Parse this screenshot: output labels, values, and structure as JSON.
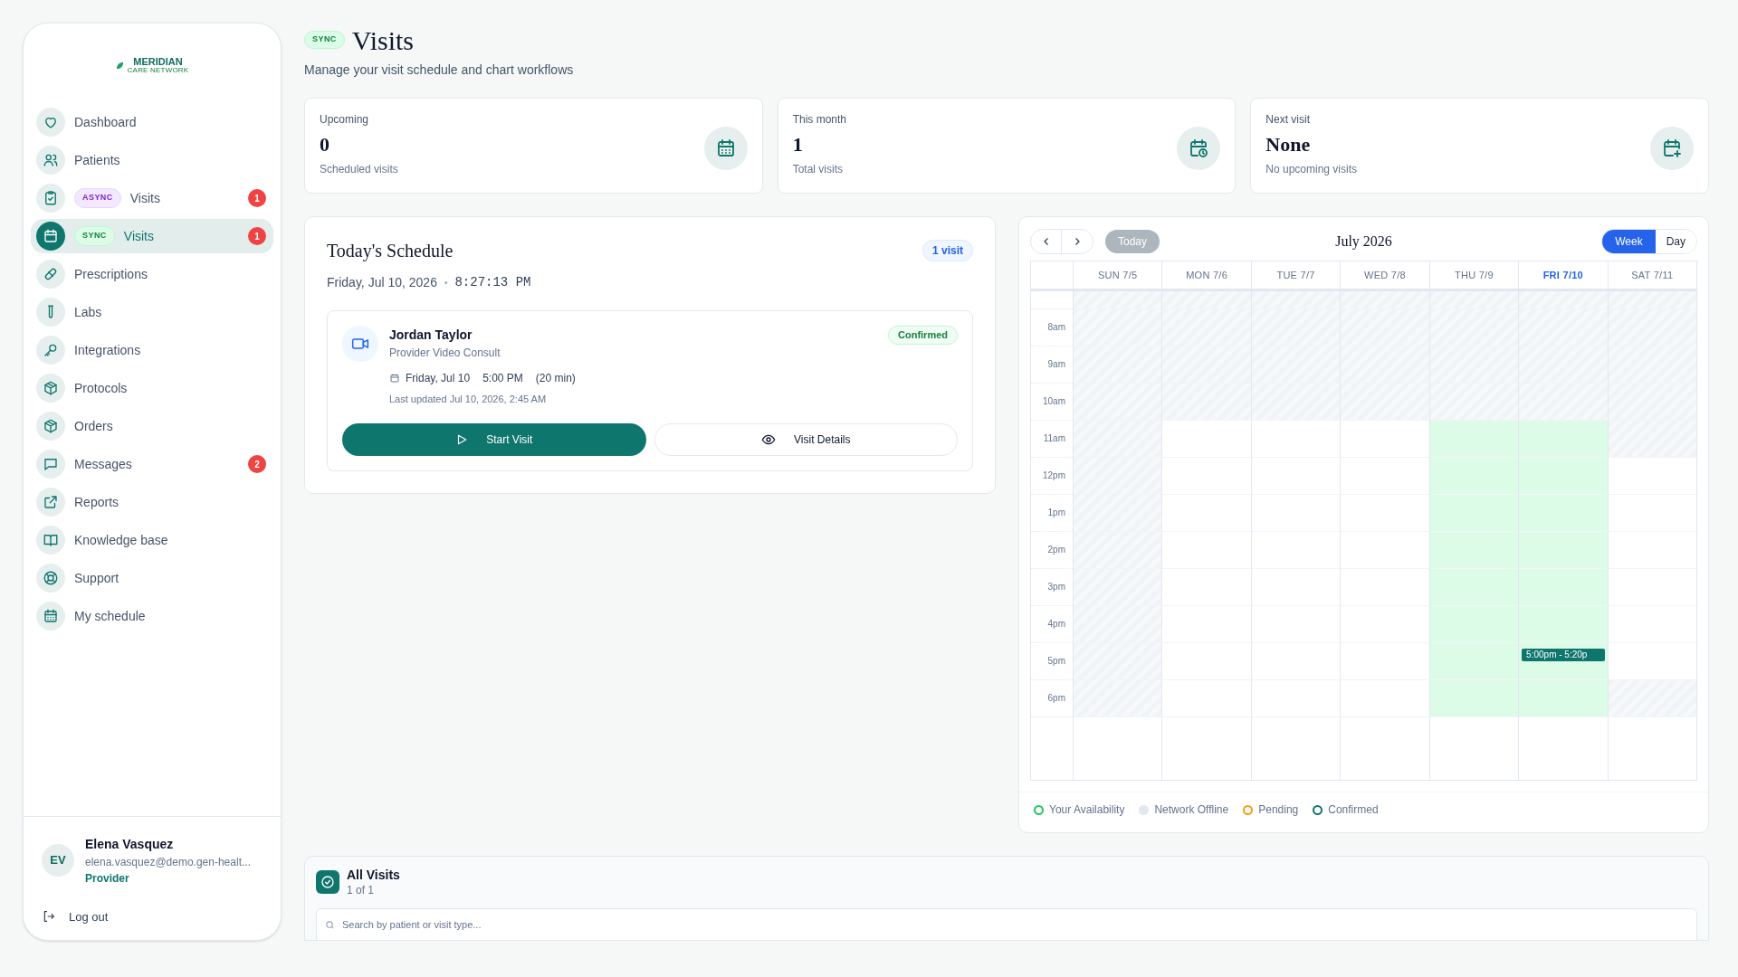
{
  "logo": {
    "name": "MERIDIAN",
    "tagline": "CARE NETWORK"
  },
  "sidebar": {
    "items": [
      {
        "kind": "heart",
        "label": "Dashboard",
        "selected": false
      },
      {
        "kind": "users",
        "label": "Patients",
        "selected": false
      },
      {
        "kind": "clipboard",
        "label": "Visits",
        "tag": {
          "label": "ASYNC",
          "kind": "async"
        },
        "badge": "1",
        "selected": false
      },
      {
        "kind": "calendar",
        "label": "Visits",
        "tag": {
          "label": "SYNC",
          "kind": "sync"
        },
        "badge": "1",
        "selected": true
      },
      {
        "kind": "pill",
        "label": "Prescriptions",
        "selected": false
      },
      {
        "kind": "tube",
        "label": "Labs",
        "selected": false
      },
      {
        "kind": "key",
        "label": "Integrations",
        "selected": false
      },
      {
        "kind": "box",
        "label": "Protocols",
        "selected": false
      },
      {
        "kind": "box",
        "label": "Orders",
        "selected": false
      },
      {
        "kind": "message",
        "label": "Messages",
        "badge": "2",
        "selected": false
      },
      {
        "kind": "external",
        "label": "Reports",
        "selected": false
      },
      {
        "kind": "book",
        "label": "Knowledge base",
        "selected": false
      },
      {
        "kind": "lifebuoy",
        "label": "Support",
        "selected": false
      },
      {
        "kind": "grid",
        "label": "My schedule",
        "selected": false
      }
    ],
    "user": {
      "initials": "EV",
      "name": "Elena Vasquez",
      "email": "elena.vasquez@demo.gen-healt...",
      "role": "Provider"
    },
    "logout": "Log out"
  },
  "header": {
    "tag": "SYNC",
    "title": "Visits",
    "subtitle": "Manage your visit schedule and chart workflows"
  },
  "stats": [
    {
      "label": "Upcoming",
      "value": "0",
      "caption": "Scheduled visits",
      "kind": "grid"
    },
    {
      "label": "This month",
      "value": "1",
      "caption": "Total visits",
      "kind": "clock"
    },
    {
      "label": "Next visit",
      "value": "None",
      "caption": "No upcoming visits",
      "kind": "plus"
    }
  ],
  "schedule": {
    "title": "Today's Schedule",
    "count": "1 visit",
    "date": "Friday, Jul 10, 2026",
    "separator": "•",
    "time": "8:27:13 PM",
    "visits": [
      {
        "patient": "Jordan Taylor",
        "type": "Provider Video Consult",
        "status": "Confirmed",
        "date": "Friday, Jul 10",
        "time": "5:00 PM",
        "duration": "(20 min)",
        "updated": "Last updated Jul 10, 2026, 2:45 AM",
        "primary_action": "Start Visit",
        "secondary_action": "Visit Details"
      }
    ]
  },
  "calendar": {
    "title": "July 2026",
    "today": "Today",
    "views": [
      {
        "label": "Week",
        "selected": true
      },
      {
        "label": "Day",
        "selected": false
      }
    ],
    "time_labels": [
      "8am",
      "9am",
      "10am",
      "11am",
      "12pm",
      "1pm",
      "2pm",
      "3pm",
      "4pm",
      "5pm",
      "6pm"
    ],
    "days": [
      {
        "label": "SUN 7/5",
        "selected": false,
        "slots": [
          {
            "kind": "offline"
          },
          {
            "kind": "offline"
          },
          {
            "kind": "offline"
          },
          {
            "kind": "offline"
          },
          {
            "kind": "offline"
          },
          {
            "kind": "offline"
          },
          {
            "kind": "offline"
          },
          {
            "kind": "offline"
          },
          {
            "kind": "offline"
          },
          {
            "kind": "offline"
          },
          {
            "kind": "offline"
          },
          {
            "kind": "offline"
          }
        ]
      },
      {
        "label": "MON 7/6",
        "selected": false,
        "slots": [
          {
            "kind": "offline"
          },
          {
            "kind": "offline"
          },
          {
            "kind": "offline"
          },
          {
            "kind": "offline"
          },
          {
            "kind": "open"
          },
          {
            "kind": "open"
          },
          {
            "kind": "open"
          },
          {
            "kind": "open"
          },
          {
            "kind": "open"
          },
          {
            "kind": "open"
          },
          {
            "kind": "open"
          },
          {
            "kind": "open"
          }
        ]
      },
      {
        "label": "TUE 7/7",
        "selected": false,
        "slots": [
          {
            "kind": "offline"
          },
          {
            "kind": "offline"
          },
          {
            "kind": "offline"
          },
          {
            "kind": "offline"
          },
          {
            "kind": "open"
          },
          {
            "kind": "open"
          },
          {
            "kind": "open"
          },
          {
            "kind": "open"
          },
          {
            "kind": "open"
          },
          {
            "kind": "open"
          },
          {
            "kind": "open"
          },
          {
            "kind": "open"
          }
        ]
      },
      {
        "label": "WED 7/8",
        "selected": false,
        "slots": [
          {
            "kind": "offline"
          },
          {
            "kind": "offline"
          },
          {
            "kind": "offline"
          },
          {
            "kind": "offline"
          },
          {
            "kind": "open"
          },
          {
            "kind": "open"
          },
          {
            "kind": "open"
          },
          {
            "kind": "open"
          },
          {
            "kind": "open"
          },
          {
            "kind": "open"
          },
          {
            "kind": "open"
          },
          {
            "kind": "open"
          }
        ]
      },
      {
        "label": "THU 7/9",
        "selected": false,
        "slots": [
          {
            "kind": "offline"
          },
          {
            "kind": "offline"
          },
          {
            "kind": "offline"
          },
          {
            "kind": "offline"
          },
          {
            "kind": "available"
          },
          {
            "kind": "available"
          },
          {
            "kind": "available"
          },
          {
            "kind": "available"
          },
          {
            "kind": "available"
          },
          {
            "kind": "available"
          },
          {
            "kind": "available"
          },
          {
            "kind": "available"
          }
        ]
      },
      {
        "label": "FRI 7/10",
        "selected": true,
        "slots": [
          {
            "kind": "offline"
          },
          {
            "kind": "offline"
          },
          {
            "kind": "offline"
          },
          {
            "kind": "offline"
          },
          {
            "kind": "available"
          },
          {
            "kind": "available"
          },
          {
            "kind": "available"
          },
          {
            "kind": "available"
          },
          {
            "kind": "available"
          },
          {
            "kind": "available"
          },
          {
            "kind": "available",
            "event": "5:00pm - 5:20p"
          },
          {
            "kind": "available"
          }
        ]
      },
      {
        "label": "SAT 7/11",
        "selected": false,
        "slots": [
          {
            "kind": "offline"
          },
          {
            "kind": "offline"
          },
          {
            "kind": "offline"
          },
          {
            "kind": "offline"
          },
          {
            "kind": "offline"
          },
          {
            "kind": "open"
          },
          {
            "kind": "open"
          },
          {
            "kind": "open"
          },
          {
            "kind": "open"
          },
          {
            "kind": "open"
          },
          {
            "kind": "open"
          },
          {
            "kind": "offline"
          }
        ]
      }
    ],
    "legend": [
      {
        "label": "Your Availability",
        "kind": "ring",
        "color": "#22c55e"
      },
      {
        "label": "Network Offline",
        "kind": "dot",
        "color": "#e2e8f0"
      },
      {
        "label": "Pending",
        "kind": "ring",
        "color": "#f59e0b"
      },
      {
        "label": "Confirmed",
        "kind": "ring",
        "color": "#0f766e"
      }
    ]
  },
  "all_visits": {
    "title": "All Visits",
    "count": "1 of 1",
    "search": {
      "placeholder": "Search by patient or visit type..."
    }
  }
}
